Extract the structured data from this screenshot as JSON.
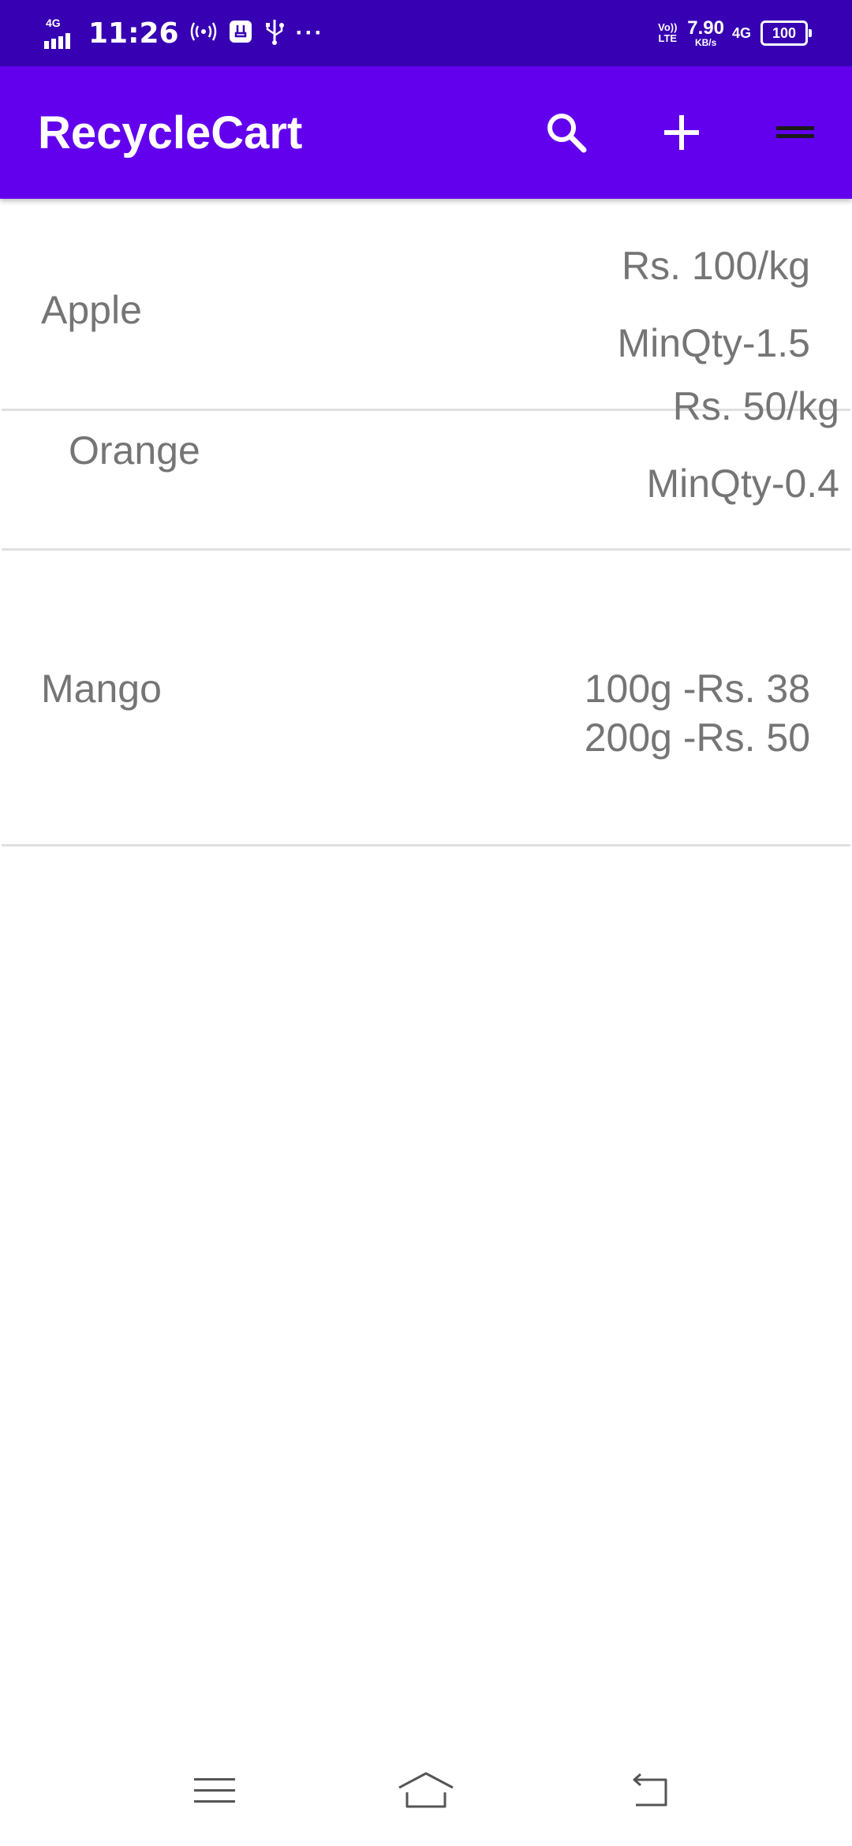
{
  "status_bar": {
    "network_left": "4G",
    "time": "11:26",
    "volte": "Vo)) LTE",
    "speed_value": "7.90",
    "speed_unit": "KB/s",
    "network_right": "4G",
    "battery": "100",
    "more": "···"
  },
  "app_bar": {
    "title": "RecycleCart",
    "actions": [
      {
        "name": "search",
        "icon": "search-icon"
      },
      {
        "name": "add",
        "icon": "plus-icon"
      },
      {
        "name": "menu",
        "icon": "menu-icon"
      }
    ]
  },
  "items": [
    {
      "name": "Apple",
      "price_line1": "Rs. 100/kg",
      "price_line2": "MinQty-1.5"
    },
    {
      "name": "Orange",
      "price_line1": "Rs. 50/kg",
      "price_line2": "MinQty-0.4"
    },
    {
      "name": "Mango",
      "price_line1": "100g -Rs. 38",
      "price_line2": "200g -Rs. 50"
    }
  ],
  "nav_bar": {
    "buttons": [
      {
        "name": "recents",
        "icon": "recents-icon"
      },
      {
        "name": "home",
        "icon": "home-icon"
      },
      {
        "name": "back",
        "icon": "back-icon"
      }
    ]
  },
  "colors": {
    "status_bar": "#3700b3",
    "app_bar": "#6200ee",
    "text_gray": "#757575",
    "divider": "#e0e0e0"
  }
}
